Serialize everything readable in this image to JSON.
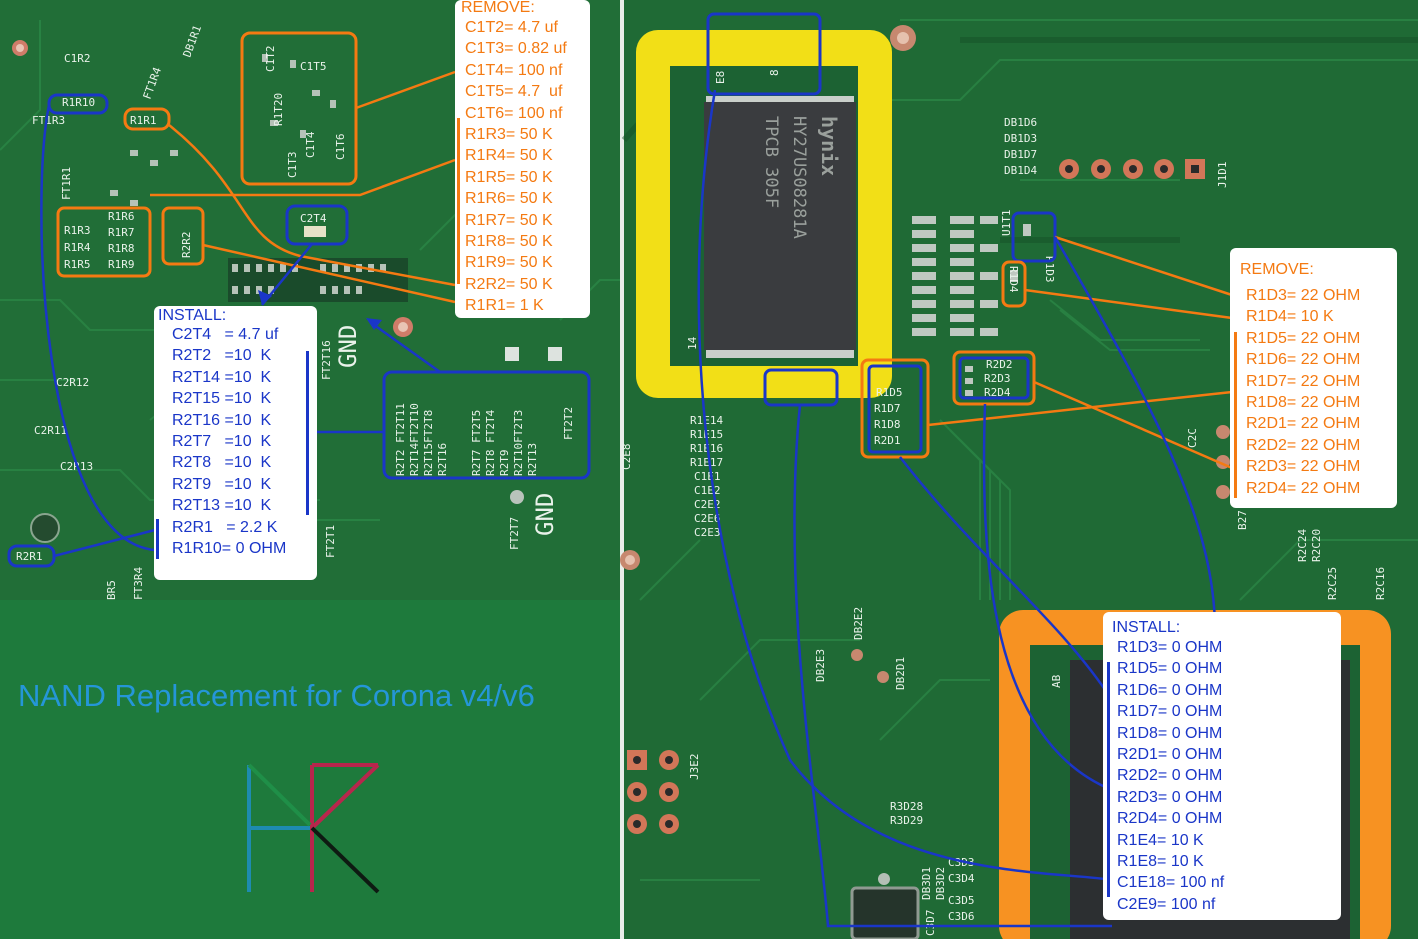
{
  "title": "NAND Replacement for Corona v4/v6",
  "colors": {
    "pcb": "#1f6b35",
    "pcb_dark": "#174f2a",
    "remove": "#f47a12",
    "install": "#1a36c8",
    "highlight_yellow": "#f2df17",
    "highlight_orange": "#f79222",
    "title_blue": "#2596d8"
  },
  "chip_label": {
    "brand": "hynix",
    "part": "HY27US08281A",
    "code": "TPCB 305F"
  },
  "gnd_label": "GND",
  "left_remove": {
    "heading": "REMOVE:",
    "items": [
      "C1T2= 4.7 uf",
      "C1T3= 0.82 uf",
      "C1T4= 100 nf",
      "C1T5= 4.7  uf",
      "C1T6= 100 nf",
      "R1R3= 50 K",
      "R1R4= 50 K",
      "R1R5= 50 K",
      "R1R6= 50 K",
      "R1R7= 50 K",
      "R1R8= 50 K",
      "R1R9= 50 K",
      "R2R2= 50 K",
      "R1R1= 1 K"
    ]
  },
  "left_install": {
    "heading": "INSTALL:",
    "items": [
      "C2T4   = 4.7 uf",
      "R2T2   =10  K",
      "R2T14 =10  K",
      "R2T15 =10  K",
      "R2T16 =10  K",
      "R2T7   =10  K",
      "R2T8   =10  K",
      "R2T9   =10  K",
      "R2T13 =10  K",
      "R2R1   = 2.2 K",
      "R1R10= 0 OHM"
    ]
  },
  "right_remove": {
    "heading": "REMOVE:",
    "items": [
      "R1D3= 22 OHM",
      "R1D4= 10 K",
      "R1D5= 22 OHM",
      "R1D6= 22 OHM",
      "R1D7= 22 OHM",
      "R1D8= 22 OHM",
      "R2D1= 22 OHM",
      "R2D2= 22 OHM",
      "R2D3= 22 OHM",
      "R2D4= 22 OHM"
    ]
  },
  "right_install": {
    "heading": "INSTALL:",
    "items": [
      "R1D3= 0 OHM",
      "R1D5= 0 OHM",
      "R1D6= 0 OHM",
      "R1D7= 0 OHM",
      "R1D8= 0 OHM",
      "R2D1= 0 OHM",
      "R2D2= 0 OHM",
      "R2D3= 0 OHM",
      "R2D4= 0 OHM",
      "R1E4= 10 K",
      "R1E8= 10 K",
      "C1E18= 100 nf",
      "C2E9= 100 nf"
    ]
  },
  "box_labels": {
    "r1r10": "R1R10",
    "r1r1": "R1R1",
    "r2r1": "R2R1",
    "c2t4": "C2T4",
    "ft1r3": "FT1R3",
    "c1r2": "C1R2",
    "db1r1": "DB1R1",
    "ft1r4": "FT1R4",
    "ft1r1": "FT1R1",
    "c1t2": "C1T2",
    "c1t5": "C1T5",
    "r1t20": "R1T20",
    "c1t3": "C1T3",
    "c1t4": "C1T4",
    "c1t6": "C1T6",
    "r1r3": "R1R3",
    "r1r4": "R1R4",
    "r1r5": "R1R5",
    "r1r6": "R1R6",
    "r1r7": "R1R7",
    "r1r8": "R1R8",
    "r1r9": "R1R9",
    "r2r2": "R2R2",
    "c2r12": "C2R12",
    "c2r11": "C2R11",
    "c2r13": "C2R13",
    "ft3r4": "FT3R4",
    "br5": "BR5",
    "r2t_col1": "R2T2 FT2T11",
    "r2t_col2": "R2T14FT2T10",
    "r2t_col3": "R2T15FT2T8",
    "r2t_col4": "R2T16",
    "r2t_col5": "R2T7 FT2T5",
    "r2t_col6": "R2T8 FT2T4",
    "r2t_col7": "R2T9",
    "r2t_col8": "R2T10FT2T3",
    "r2t_col9": "R2T13",
    "r2t_col10": "FT2T2",
    "ft2t7": "FT2T7",
    "ft2t1": "FT2T1",
    "ft2t16": "FT2T16",
    "db1d6": "DB1D6",
    "db1d3": "DB1D3",
    "db1d7": "DB1D7",
    "db1d4": "DB1D4",
    "j1d1": "J1D1",
    "r1d3": "R1D3",
    "r1d4": "R1D4",
    "r1d5": "R1D5",
    "r1d7": "R1D7",
    "r1d8": "R1D8",
    "r2d1": "R2D1",
    "r2d2": "R2D2",
    "r2d3": "R2D3",
    "r2d4": "R2D4",
    "r1e14": "R1E14",
    "r1e15": "R1E15",
    "r1e16": "R1E16",
    "r1e17": "R1E17",
    "c1e1": "C1E1",
    "c1e2": "C1E2",
    "c2e2": "C2E2",
    "c2e6": "C2E6",
    "c2e3": "C2E3",
    "c2e8": "C2E8",
    "db2e2": "DB2E2",
    "db2e3": "DB2E3",
    "db2d1": "DB2D1",
    "j3e2": "J3E2",
    "r3d28": "R3D28",
    "r3d29": "R3D29",
    "c3d3": "C3D3",
    "c3d4": "C3D4",
    "c3d5": "C3D5",
    "c3d6": "C3D6",
    "db3d1": "DB3D1",
    "db3d2": "DB3D2",
    "c3d7": "C3D7",
    "ab": "AB",
    "e8": "E8",
    "pin8": "8",
    "pin14": "14",
    "u1t1": "U1T1",
    "r2c24": "R2C24",
    "r2c20": "R2C20",
    "r2c25": "R2C25",
    "r2c16": "R2C16",
    "c2c": "C2C",
    "b27": "B27"
  }
}
